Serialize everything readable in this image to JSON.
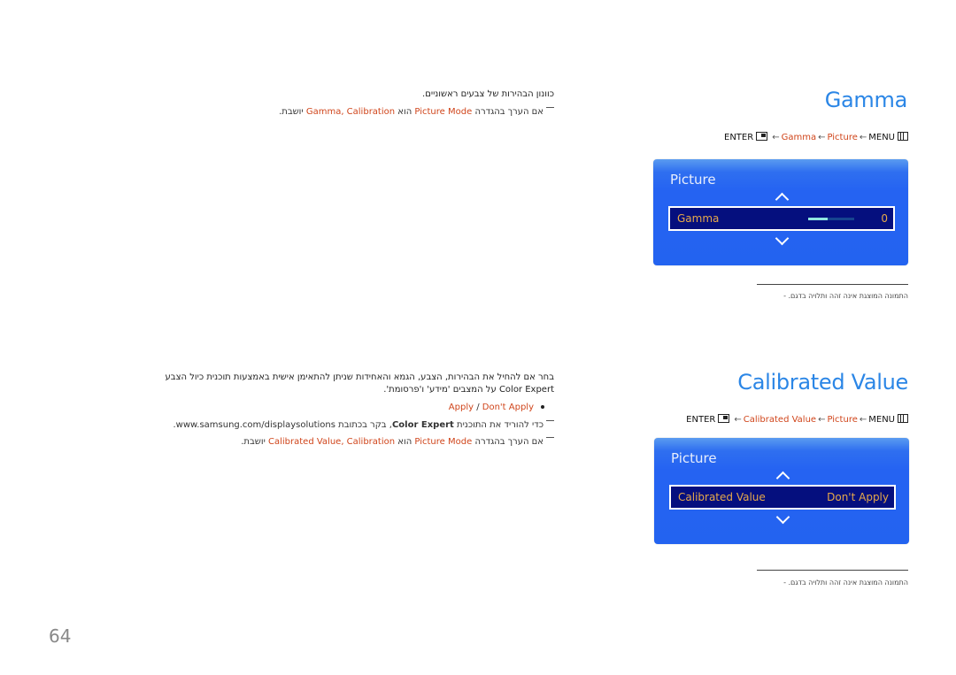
{
  "page_number": "64",
  "colors": {
    "title_blue": "#2b86e6",
    "highlight": "#d0451b",
    "osd_blue": "#2563f2",
    "osd_row_bg": "#050f7e",
    "osd_row_text": "#e7a94a"
  },
  "gamma": {
    "title": "Gamma",
    "path": {
      "enter": "ENTER",
      "enter_icon": "enter-icon",
      "arrow": "←",
      "item": "Gamma",
      "menu_section": "Picture",
      "menu": "MENU",
      "menu_icon": "menu-icon"
    },
    "osd": {
      "title": "Picture",
      "row_label": "Gamma",
      "row_value": "0",
      "slider_fill_fraction": 0.43
    },
    "caption": "התמונה המוצגת אינה זהה ותלויה בדגם.",
    "description": "כוונון הבהירות של צבעים ראשוניים.",
    "note": {
      "prefix": "אם הערך בהגדרה",
      "mode": "Picture Mode",
      "middle": "הוא",
      "values": "Gamma, Calibration",
      "suffix": "יושבת."
    }
  },
  "calibrated": {
    "title": "Calibrated Value",
    "path": {
      "enter": "ENTER",
      "enter_icon": "enter-icon",
      "arrow": "←",
      "item": "Calibrated Value",
      "menu_section": "Picture",
      "menu": "MENU",
      "menu_icon": "menu-icon"
    },
    "osd": {
      "title": "Picture",
      "row_label": "Calibrated Value",
      "row_value": "Don't Apply"
    },
    "caption": "התמונה המוצגת אינה זהה ותלויה בדגם.",
    "description_line1": "בחר אם להחיל את הבהירות, הצבע, הגמא והאחידות שניתן להתאימן אישית באמצעות תוכנית כיול הצבע",
    "description_line2_prefix": "Color Expert",
    "description_line2_suffix": "על המצבים 'מידע' ו'פרסומת'.",
    "options": {
      "apply": "Apply",
      "sep": " / ",
      "dont_apply": "Don't Apply"
    },
    "note1": {
      "prefix": "כדי להוריד את התוכנית",
      "program": "Color Expert",
      "suffix": ", בקר בכתובת www.samsung.com/displaysolutions."
    },
    "note2": {
      "prefix": "אם הערך בהגדרה",
      "mode": "Picture Mode",
      "middle": "הוא",
      "values": "Calibrated Value, Calibration",
      "suffix": "יושבת."
    }
  }
}
